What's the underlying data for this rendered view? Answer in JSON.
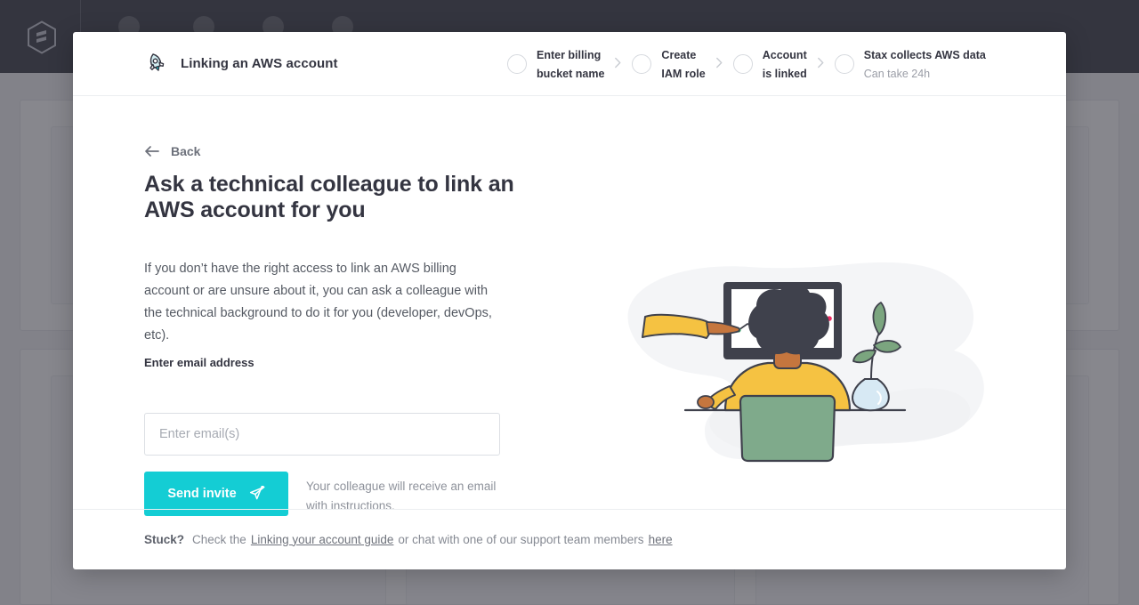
{
  "background": {
    "logo_icon": "stax-hexagon-logo",
    "nav_placeholders": 4,
    "cards": 6
  },
  "modal": {
    "header": {
      "icon": "rocket-icon",
      "title": "Linking an AWS account",
      "separator_icon": "chevron-right-icon",
      "steps": [
        {
          "label": "Enter billing\nbucket name",
          "sub": ""
        },
        {
          "label": "Create\nIAM role",
          "sub": ""
        },
        {
          "label": "Account\nis linked",
          "sub": ""
        },
        {
          "label": "Stax collects AWS data",
          "sub": "Can take 24h"
        }
      ]
    },
    "back": {
      "icon": "arrow-left-icon",
      "label": "Back"
    },
    "headline": "Ask a technical colleague to link an AWS account for you",
    "paragraph": "If you don’t have the right access to link an AWS billing account or are unsure about it, you can ask a colleague with the technical background to do it for you (developer, devOps, etc).",
    "form": {
      "field_label": "Enter email address",
      "input_value": "",
      "input_placeholder": "Enter email(s)",
      "submit_label": "Send invite",
      "submit_icon": "send-paper-plane-icon",
      "note": "Your colleague will receive an email with instructions."
    },
    "illustration": {
      "name": "person-at-desk-viewing-chart-illustration",
      "blob_color": "#f4f5f7",
      "shirt_color": "#f5c242",
      "desk_color": "#7faa8b",
      "hair_color": "#3f414c",
      "vase_color": "#d7e9f4",
      "leaf_color": "#7ba57f",
      "chart_dot_colors": [
        "#3bb273",
        "#3f51d6",
        "#ef2b64"
      ]
    },
    "footer": {
      "strong": "Stuck?",
      "text_before": "Check the",
      "link_guide": "Linking your account guide",
      "text_middle": "or chat with one of our support team members",
      "link_here": "here"
    }
  },
  "colors": {
    "accent": "#14cdd4",
    "topbar": "#34353f",
    "text_dark": "#343541",
    "text_muted": "#8e929b",
    "border": "#dcdfe4"
  }
}
